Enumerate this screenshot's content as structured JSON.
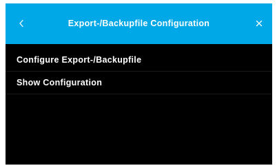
{
  "header": {
    "title": "Export-/Backupfile Configuration",
    "back_icon": "chevron-left-icon",
    "close_icon": "close-icon"
  },
  "menu": {
    "items": [
      {
        "label": "Configure Export-/Backupfile"
      },
      {
        "label": "Show Configuration"
      }
    ]
  },
  "colors": {
    "header_background": "#00a8e8",
    "panel_background": "#000000",
    "text": "#ffffff"
  }
}
